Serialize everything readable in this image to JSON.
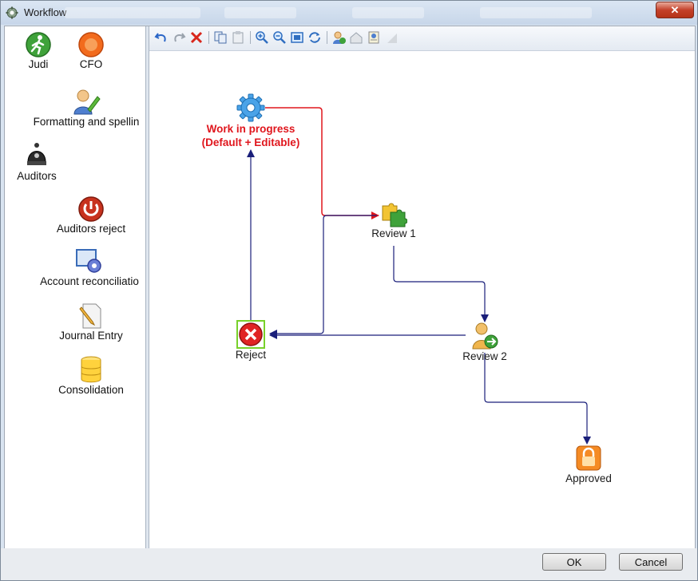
{
  "window": {
    "title": "Workflow",
    "close_label": "✕"
  },
  "palette": {
    "items": [
      {
        "label": "Judi",
        "icon": "runner-icon"
      },
      {
        "label": "CFO",
        "icon": "orange-circle-icon"
      },
      {
        "label": "Formatting and spellin",
        "icon": "user-pencil-icon"
      },
      {
        "label": "Auditors",
        "icon": "police-helmet-icon"
      },
      {
        "label": "Auditors reject",
        "icon": "power-button-icon"
      },
      {
        "label": "Account reconciliatio",
        "icon": "monitor-gear-icon"
      },
      {
        "label": "Journal Entry",
        "icon": "document-pencil-icon"
      },
      {
        "label": "Consolidation",
        "icon": "database-icon"
      }
    ]
  },
  "toolbar": {
    "buttons": [
      "undo-icon",
      "redo-icon",
      "delete-icon",
      "copy-icon",
      "paste-icon",
      "zoom-in-icon",
      "zoom-out-icon",
      "fit-icon",
      "refresh-icon",
      "add-user-icon",
      "home-icon",
      "properties-icon",
      "resize-grip-icon"
    ]
  },
  "workflow": {
    "nodes": {
      "start": {
        "line1": "Work in progress",
        "line2": "(Default + Editable)",
        "icon": "gear-icon"
      },
      "review1": {
        "label": "Review 1",
        "icon": "puzzle-icon"
      },
      "review2": {
        "label": "Review 2",
        "icon": "user-forward-icon"
      },
      "reject": {
        "label": "Reject",
        "icon": "reject-x-icon"
      },
      "approved": {
        "label": "Approved",
        "icon": "padlock-icon"
      }
    },
    "colors": {
      "default_transition": "#e0161d",
      "transition": "#1a1f7a",
      "default_label": "#e0161d"
    }
  },
  "dialog": {
    "ok_label": "OK",
    "cancel_label": "Cancel"
  }
}
